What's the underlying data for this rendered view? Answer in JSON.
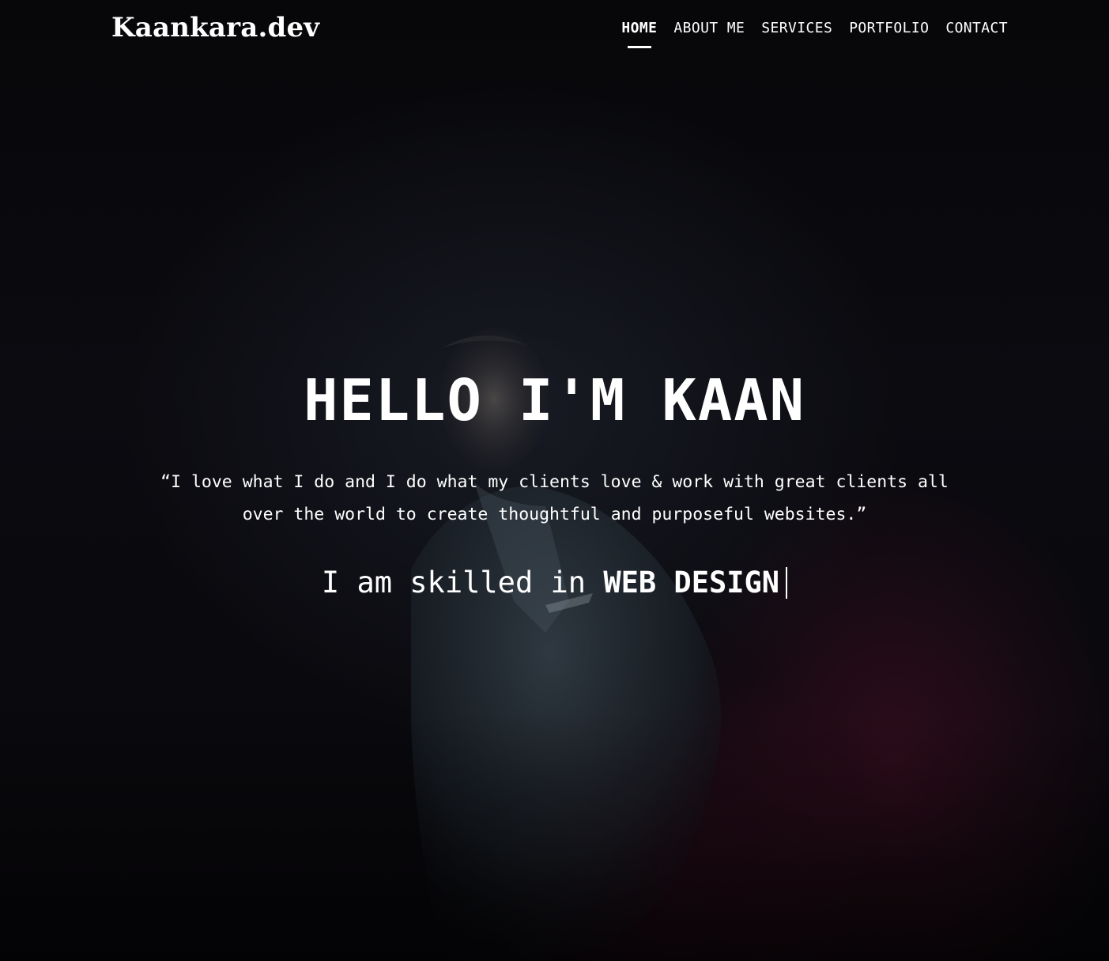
{
  "site": {
    "logo": "Kaankara.dev"
  },
  "nav": {
    "items": [
      {
        "label": "HOME",
        "active": true
      },
      {
        "label": "ABOUT ME",
        "active": false
      },
      {
        "label": "SERVICES",
        "active": false
      },
      {
        "label": "PORTFOLIO",
        "active": false
      },
      {
        "label": "CONTACT",
        "active": false
      }
    ]
  },
  "hero": {
    "title": "HELLO I'M KAAN",
    "quote": "“I love what I do and I do what my clients love & work with great clients all over the world to create thoughtful and purposeful websites.”",
    "skills_prefix": "I am skilled in",
    "skills_current": "WEB DESIGN"
  },
  "colors": {
    "text": "#ffffff",
    "background": "#07070a",
    "accent_glow": "#781437"
  }
}
